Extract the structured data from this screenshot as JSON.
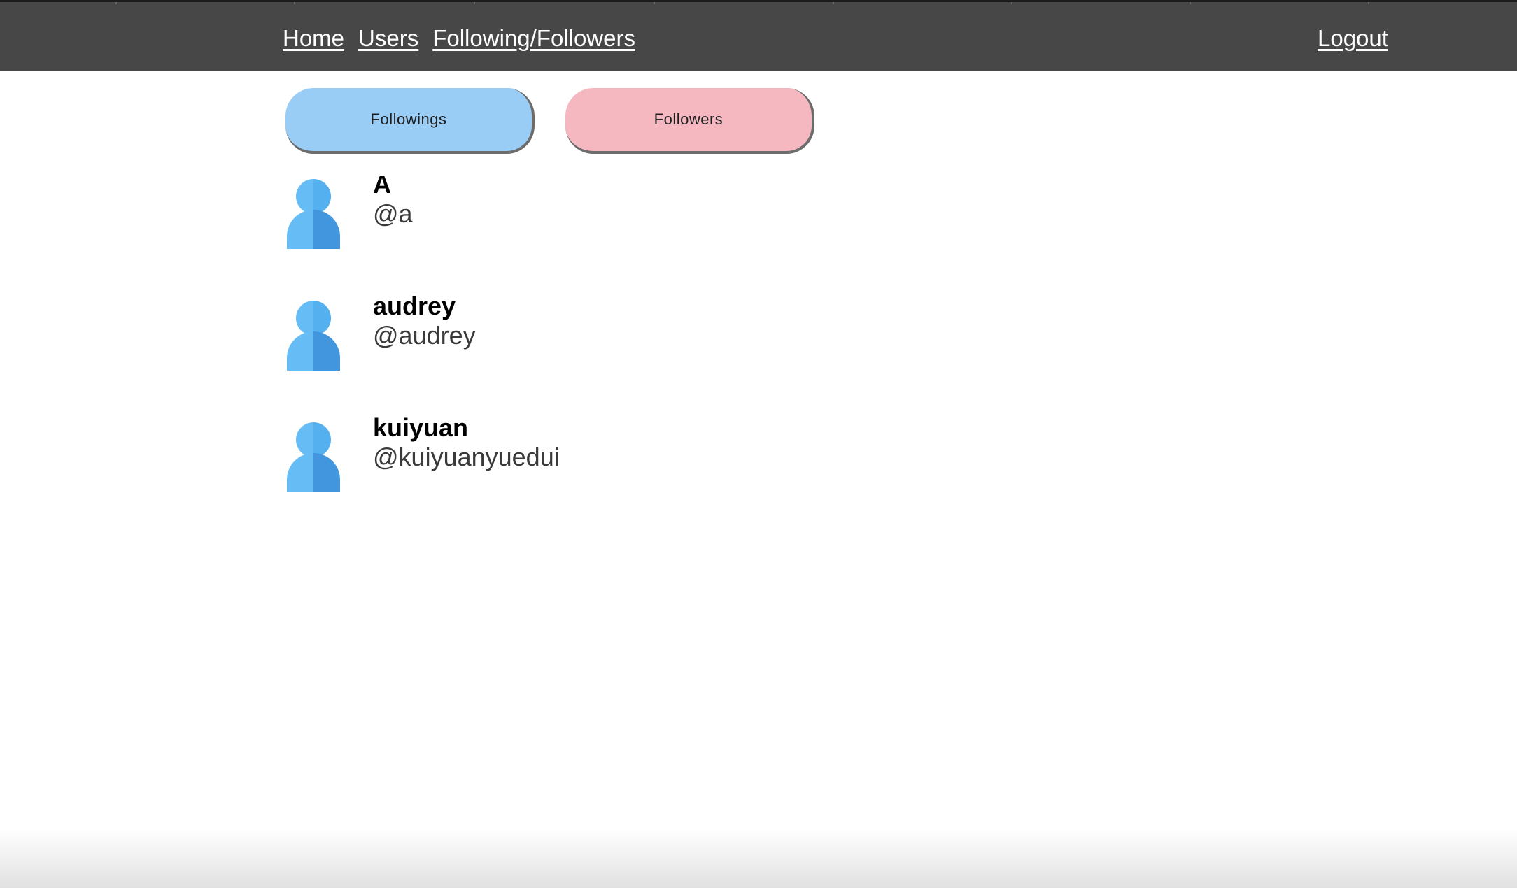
{
  "nav": {
    "home_label": "Home",
    "users_label": "Users",
    "follow_label": "Following/Followers",
    "logout_label": "Logout"
  },
  "tabs": {
    "followings_label": "Followings",
    "followers_label": "Followers"
  },
  "users": [
    {
      "name": "A",
      "handle": "@a"
    },
    {
      "name": "audrey",
      "handle": "@audrey"
    },
    {
      "name": "kuiyuan",
      "handle": "@kuiyuanyuedui"
    }
  ],
  "colors": {
    "navbar_bg": "#474747",
    "followings_tab": "#9acdf6",
    "followers_tab": "#f5b8c1",
    "avatar_light": "#66bdf6",
    "avatar_dark": "#4196de"
  },
  "icons": {
    "avatar": "person-icon"
  }
}
